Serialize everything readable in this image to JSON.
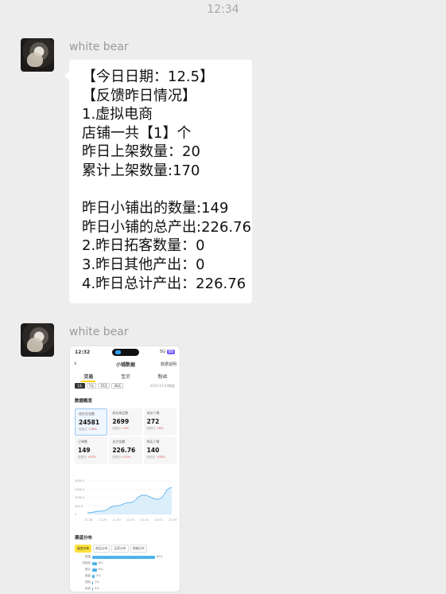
{
  "time_divider": "12:34",
  "messages": [
    {
      "sender": "white bear",
      "type": "text",
      "lines": [
        "【今日日期：12.5】",
        "【反馈昨日情况】",
        "1.虚拟电商",
        "店铺一共【1】个",
        "昨日上架数量：20",
        "累计上架数量:170",
        "",
        "昨日小铺出的数量:149",
        "昨日小铺的总产出:226.76",
        "2.昨日拓客数量：0",
        "3.昨日其他产出：0",
        "4.昨日总计产出：226.76"
      ]
    },
    {
      "sender": "white bear",
      "type": "image"
    }
  ],
  "screenshot": {
    "status_time": "12:32",
    "status_right": "5G",
    "status_pill": "89",
    "nav_title": "小铺数据",
    "nav_right": "数据说明",
    "tabs": [
      "交易",
      "宝贝",
      "粉丝"
    ],
    "ranges": [
      "1天",
      "7天",
      "15天",
      "30天"
    ],
    "range_date": "2023-12-04数据",
    "overview_title": "数据概览",
    "metrics": [
      {
        "label": "成交总金额",
        "value": "24581",
        "compare": "较前日",
        "delta": "+18%"
      },
      {
        "label": "成交商品数",
        "value": "2699",
        "compare": "较前日",
        "delta": "+9%"
      },
      {
        "label": "成交人数",
        "value": "272",
        "compare": "较前日",
        "delta": "+6%"
      },
      {
        "label": "订单数",
        "value": "149",
        "compare": "较前日",
        "delta": "+37%"
      },
      {
        "label": "支付金额",
        "value": "226.76",
        "compare": "较前日",
        "delta": "+32%"
      },
      {
        "label": "购买人数",
        "value": "140",
        "compare": "较前日",
        "delta": "+33%"
      }
    ],
    "chart_data": {
      "type": "area",
      "y_ticks": [
        "2000.0",
        "1500.0",
        "1000.0",
        "500.0",
        "0"
      ],
      "x_ticks": [
        "11.28",
        "11.29",
        "11.30",
        "12.01",
        "12.02",
        "12.03",
        "12.04"
      ],
      "values": [
        100,
        200,
        500,
        700,
        1150,
        900,
        1600
      ],
      "ylim": [
        0,
        2000
      ],
      "color": "#66b8ea"
    },
    "channel_title": "渠道分布",
    "chips": [
      "成交分布",
      "商品分布",
      "买家分布",
      "地域分布"
    ],
    "channels": [
      {
        "label": "直播",
        "pct": 82
      },
      {
        "label": "短视频",
        "pct": 6
      },
      {
        "label": "图文",
        "pct": 6
      },
      {
        "label": "橱窗",
        "pct": 3
      },
      {
        "label": "搜索",
        "pct": 1
      },
      {
        "label": "其他",
        "pct": 0
      }
    ]
  }
}
